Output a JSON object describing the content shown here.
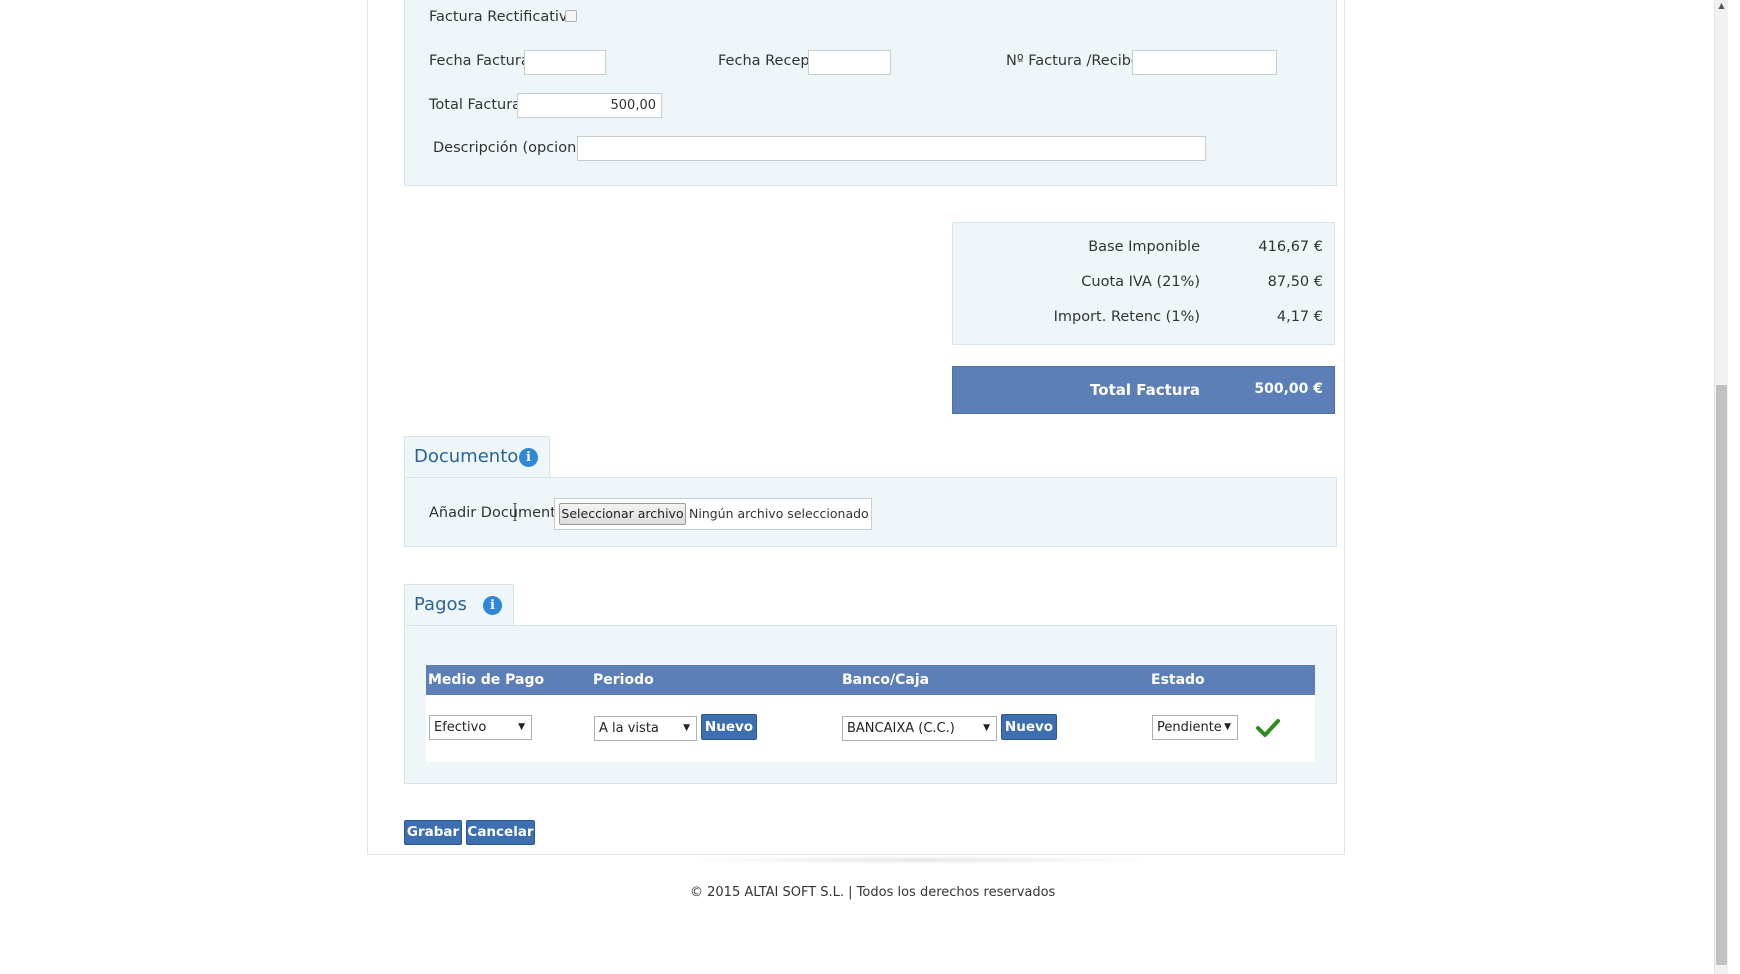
{
  "form": {
    "rectificativa_label": "Factura Rectificativa",
    "fecha_factura_label": "Fecha Factura",
    "fecha_factura_value": "",
    "fecha_recep_label": "Fecha Recep.",
    "fecha_recep_value": "",
    "num_factura_label": "Nº Factura /Recibo",
    "num_factura_value": "",
    "total_factura_label": "Total Factura",
    "total_factura_value": "500,00",
    "descripcion_label": "Descripción (opcional)",
    "descripcion_value": ""
  },
  "summary": {
    "base_label": "Base Imponible",
    "base_value": "416,67 €",
    "iva_label": "Cuota IVA (21%)",
    "iva_value": "87,50 €",
    "retenc_label": "Import. Retenc (1%)",
    "retenc_value": "4,17 €",
    "total_label": "Total Factura",
    "total_value": "500,00 €"
  },
  "documento": {
    "tab_title": "Documento",
    "add_label": "Añadir Documento",
    "file_button": "Seleccionar archivo",
    "file_status": "Ningún archivo seleccionado"
  },
  "pagos": {
    "tab_title": "Pagos",
    "headers": [
      "Medio de Pago",
      "Periodo",
      "Banco/Caja",
      "Estado"
    ],
    "row": {
      "medio": "Efectivo",
      "periodo": "A la vista",
      "banco": "BANCAIXA (C.C.)",
      "estado": "Pendiente",
      "nuevo_label": "Nuevo"
    }
  },
  "actions": {
    "grabar": "Grabar",
    "cancelar": "Cancelar"
  },
  "footer": {
    "copyright": "© 2015 ALTAI SOFT S.L. | Todos los derechos reservados"
  },
  "colors": {
    "header_blue": "#5c7fb8",
    "button_blue": "#3d6eb0",
    "panel_bg": "#eef6f9",
    "check_green": "#2e8b1e"
  }
}
